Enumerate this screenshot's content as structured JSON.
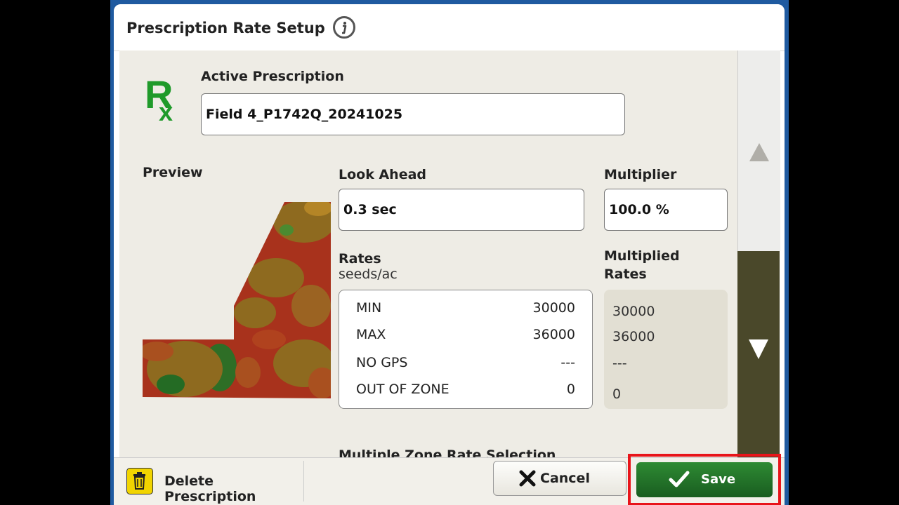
{
  "dialog": {
    "title": "Prescription Rate Setup"
  },
  "active_prescription": {
    "label": "Active Prescription",
    "value": "Field 4_P1742Q_20241025"
  },
  "preview": {
    "label": "Preview"
  },
  "look_ahead": {
    "label": "Look Ahead",
    "value": "0.3 sec"
  },
  "multiplier": {
    "label": "Multiplier",
    "value": "100.0 %"
  },
  "rates": {
    "label": "Rates",
    "unit": "seeds/ac",
    "rows": [
      {
        "key": "MIN",
        "value": "30000"
      },
      {
        "key": "MAX",
        "value": "36000"
      },
      {
        "key": "NO GPS",
        "value": "---"
      },
      {
        "key": "OUT OF ZONE",
        "value": "0"
      }
    ]
  },
  "multiplied_rates": {
    "label_line1": "Multiplied",
    "label_line2": "Rates",
    "values": [
      "30000",
      "36000",
      "---",
      "0"
    ]
  },
  "partial_section": {
    "label": "Multiple Zone Rate Selection"
  },
  "footer": {
    "delete_label": "Delete Prescription",
    "cancel_label": "Cancel",
    "save_label": "Save"
  },
  "colors": {
    "accent_green": "#1f7a24",
    "highlight_red": "#e8141a",
    "delete_yellow": "#f1d400"
  },
  "icons": {
    "info": "info-icon",
    "rx": "rx-icon",
    "trash": "trash-icon",
    "cancel": "x-icon",
    "save": "check-icon",
    "scroll_up": "triangle-up-icon",
    "scroll_down": "triangle-down-icon"
  }
}
